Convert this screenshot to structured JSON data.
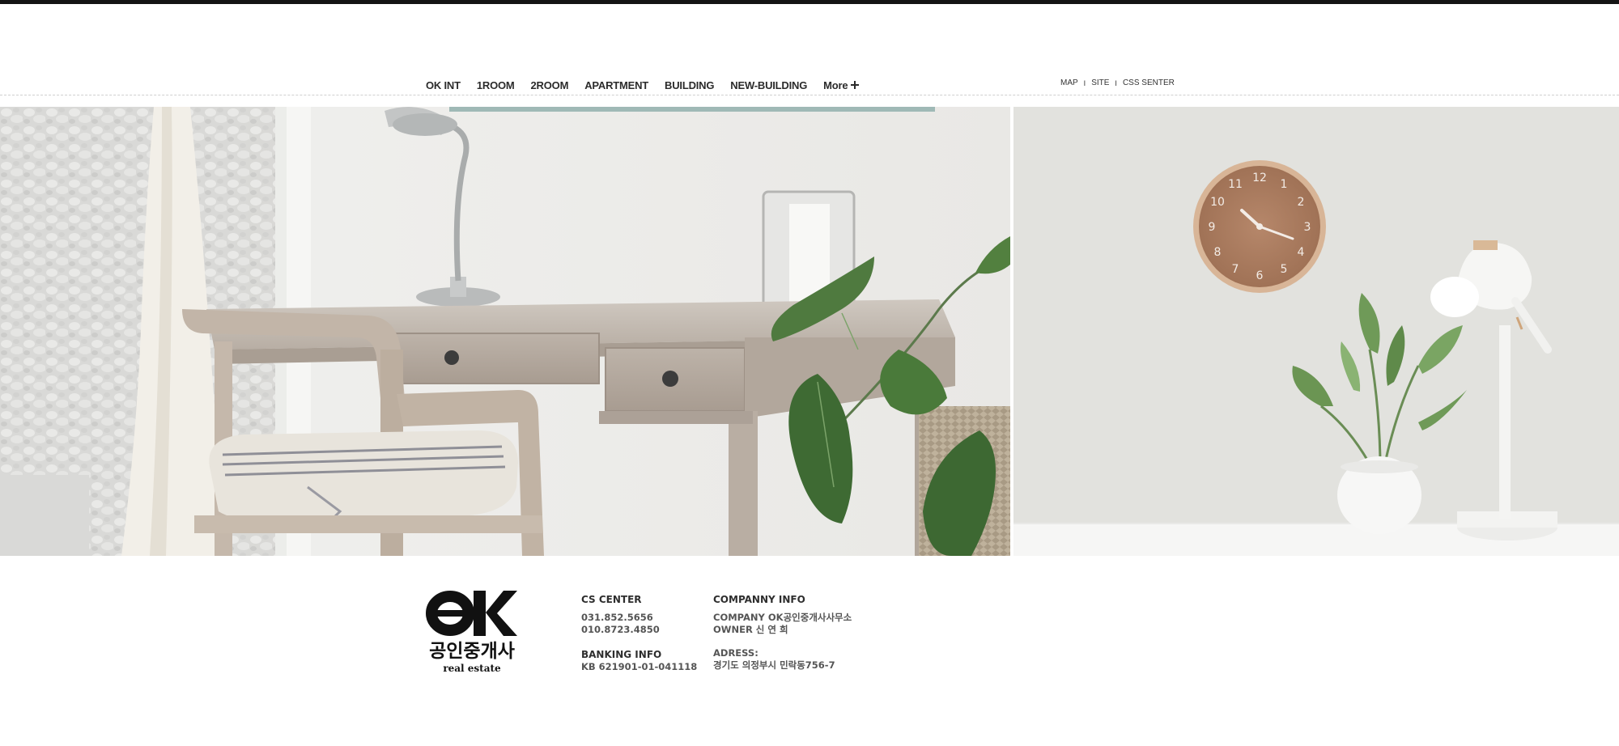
{
  "nav": {
    "items": [
      "OK INT",
      "1ROOM",
      "2ROOM",
      "APARTMENT",
      "BUILDING",
      "NEW-BUILDING"
    ],
    "more_label": "More"
  },
  "util_links": {
    "map": "MAP",
    "site": "SITE",
    "cs": "CSS SENTER",
    "separator": "I"
  },
  "hero": {
    "left_image": "desk-chair-plant-photo",
    "right_image": "wall-clock-lamp-plant-photo",
    "clock_numbers": [
      "12",
      "1",
      "2",
      "3",
      "4",
      "5",
      "6",
      "7",
      "8",
      "9",
      "10",
      "11"
    ]
  },
  "footer": {
    "logo": {
      "mark": "OK",
      "name": "공인중개사",
      "sub": "real estate"
    },
    "cs": {
      "title": "CS CENTER",
      "phone1": "031.852.5656",
      "phone2": "010.8723.4850",
      "bank_title": "BANKING INFO",
      "bank": "KB 621901-01-041118"
    },
    "company": {
      "title": "COMPANNY INFO",
      "company": "COMPANY OK공인중개사사무소",
      "owner": "OWNER 신 연 희",
      "address_title": "ADRESS:",
      "address": "경기도 의정부시 민락동756-7"
    }
  },
  "colors": {
    "topbar": "#141414",
    "nav_text": "#2b2b2b",
    "footer_text": "#555555"
  }
}
